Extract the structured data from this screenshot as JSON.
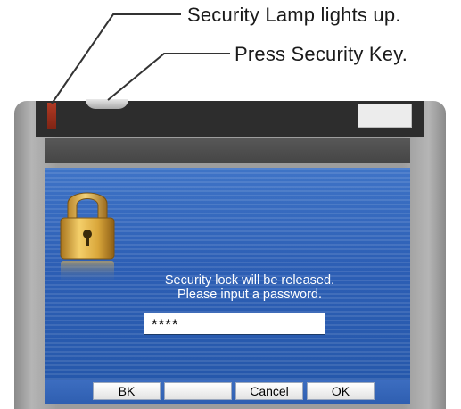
{
  "callouts": {
    "lamp": "Security Lamp lights up.",
    "key": "Press Security Key."
  },
  "dialog": {
    "message_line1": "Security lock will be released.",
    "message_line2": "Please input a password.",
    "password_value": "****"
  },
  "softkeys": {
    "bk": "BK",
    "blank": "",
    "cancel": "Cancel",
    "ok": "OK"
  },
  "colors": {
    "screen_blue": "#2d5fb5",
    "lamp_red": "#b23a24",
    "device_gray": "#9d9d9d",
    "lock_gold": "#d9a63a"
  },
  "icons": {
    "lock": "padlock-icon"
  }
}
